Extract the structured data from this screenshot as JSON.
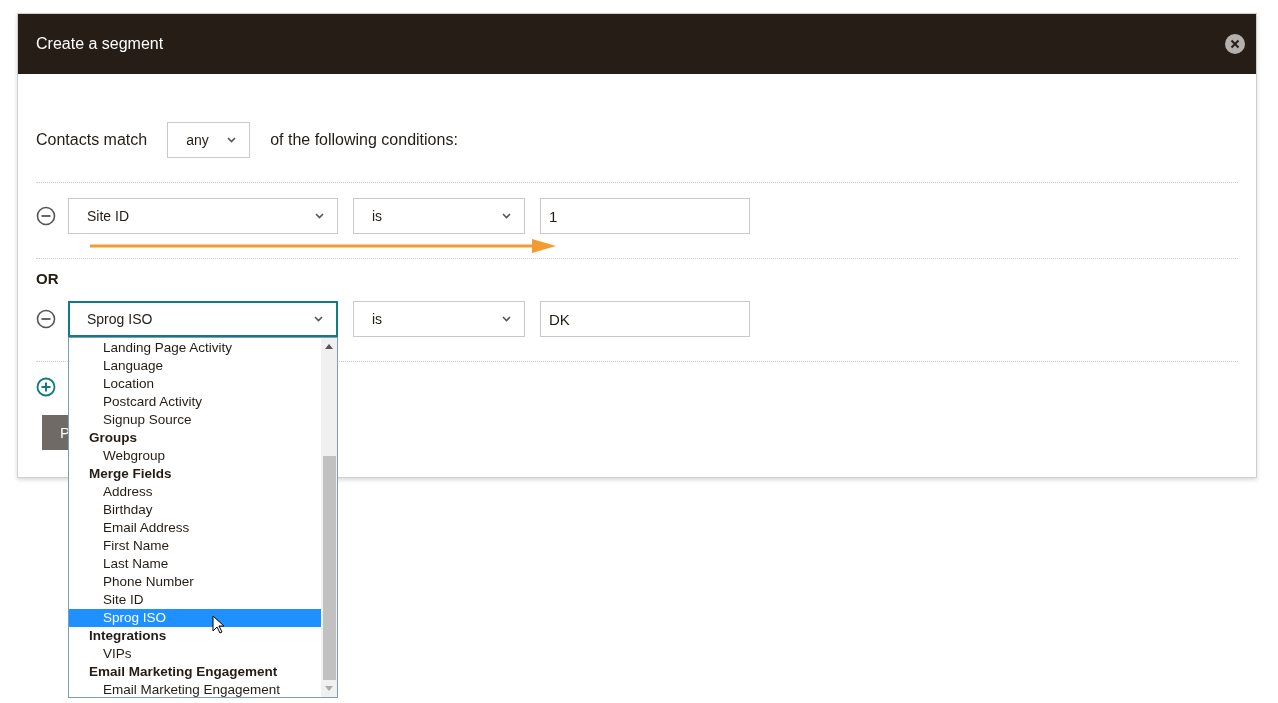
{
  "dialog": {
    "title": "Create a segment"
  },
  "match": {
    "prefix": "Contacts match",
    "value": "any",
    "suffix": "of the following conditions:"
  },
  "conditions": [
    {
      "field": "Site ID",
      "operator": "is",
      "value": "1",
      "focused": false
    },
    {
      "field": "Sprog ISO",
      "operator": "is",
      "value": "DK",
      "focused": true
    }
  ],
  "join_label": "OR",
  "field_dropdown": {
    "options": [
      {
        "kind": "option",
        "label": "Landing Page Activity",
        "selected": false
      },
      {
        "kind": "option",
        "label": "Language",
        "selected": false
      },
      {
        "kind": "option",
        "label": "Location",
        "selected": false
      },
      {
        "kind": "option",
        "label": "Postcard Activity",
        "selected": false
      },
      {
        "kind": "option",
        "label": "Signup Source",
        "selected": false
      },
      {
        "kind": "group",
        "label": "Groups",
        "selected": false
      },
      {
        "kind": "option",
        "label": "Webgroup",
        "selected": false
      },
      {
        "kind": "group",
        "label": "Merge Fields",
        "selected": false
      },
      {
        "kind": "option",
        "label": "Address",
        "selected": false
      },
      {
        "kind": "option",
        "label": "Birthday",
        "selected": false
      },
      {
        "kind": "option",
        "label": "Email Address",
        "selected": false
      },
      {
        "kind": "option",
        "label": "First Name",
        "selected": false
      },
      {
        "kind": "option",
        "label": "Last Name",
        "selected": false
      },
      {
        "kind": "option",
        "label": "Phone Number",
        "selected": false
      },
      {
        "kind": "option",
        "label": "Site ID",
        "selected": false
      },
      {
        "kind": "option",
        "label": "Sprog ISO",
        "selected": true
      },
      {
        "kind": "group",
        "label": "Integrations",
        "selected": false
      },
      {
        "kind": "option",
        "label": "VIPs",
        "selected": false
      },
      {
        "kind": "group",
        "label": "Email Marketing Engagement",
        "selected": false
      },
      {
        "kind": "option",
        "label": "Email Marketing Engagement",
        "selected": false
      }
    ]
  },
  "footer_button": {
    "label": "P"
  }
}
